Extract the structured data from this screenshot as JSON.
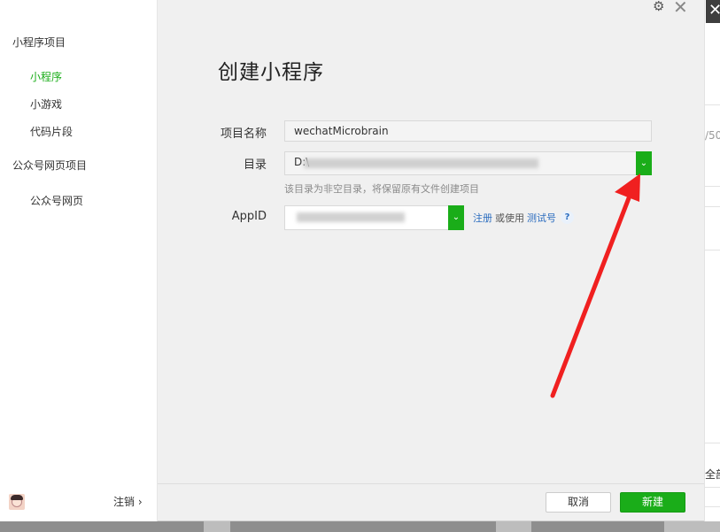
{
  "sidebar": {
    "section_miniprogram": "小程序项目",
    "items_miniprogram": [
      "小程序",
      "小游戏",
      "代码片段"
    ],
    "section_official": "公众号网页项目",
    "items_official": [
      "公众号网页"
    ],
    "logout_label": "注销 ›"
  },
  "dialog": {
    "title": "创建小程序",
    "project_name_label": "项目名称",
    "project_name_value": "wechatMicrobrain",
    "directory_label": "目录",
    "directory_value": "D:\\",
    "directory_hint": "该目录为非空目录，将保留原有文件创建项目",
    "appid_label": "AppID",
    "register_link": "注册",
    "or_use_text": "或使用",
    "test_account_link": "测试号",
    "help_symbol": "?",
    "cancel_button": "取消",
    "create_button": "新建"
  },
  "window": {
    "close_symbol": "✕",
    "gear_symbol": "⚙"
  },
  "background_app": {
    "close_symbol": "✕",
    "fragment_1": "/50",
    "fragment_2": "全部"
  },
  "icons": {
    "dropdown": "chevron-down-icon",
    "gear": "gear-icon",
    "close": "close-icon",
    "help": "help-icon"
  },
  "colors": {
    "accent_green": "#1aad19",
    "link_blue": "#2b6cbf",
    "annotation_red": "#f02020"
  }
}
